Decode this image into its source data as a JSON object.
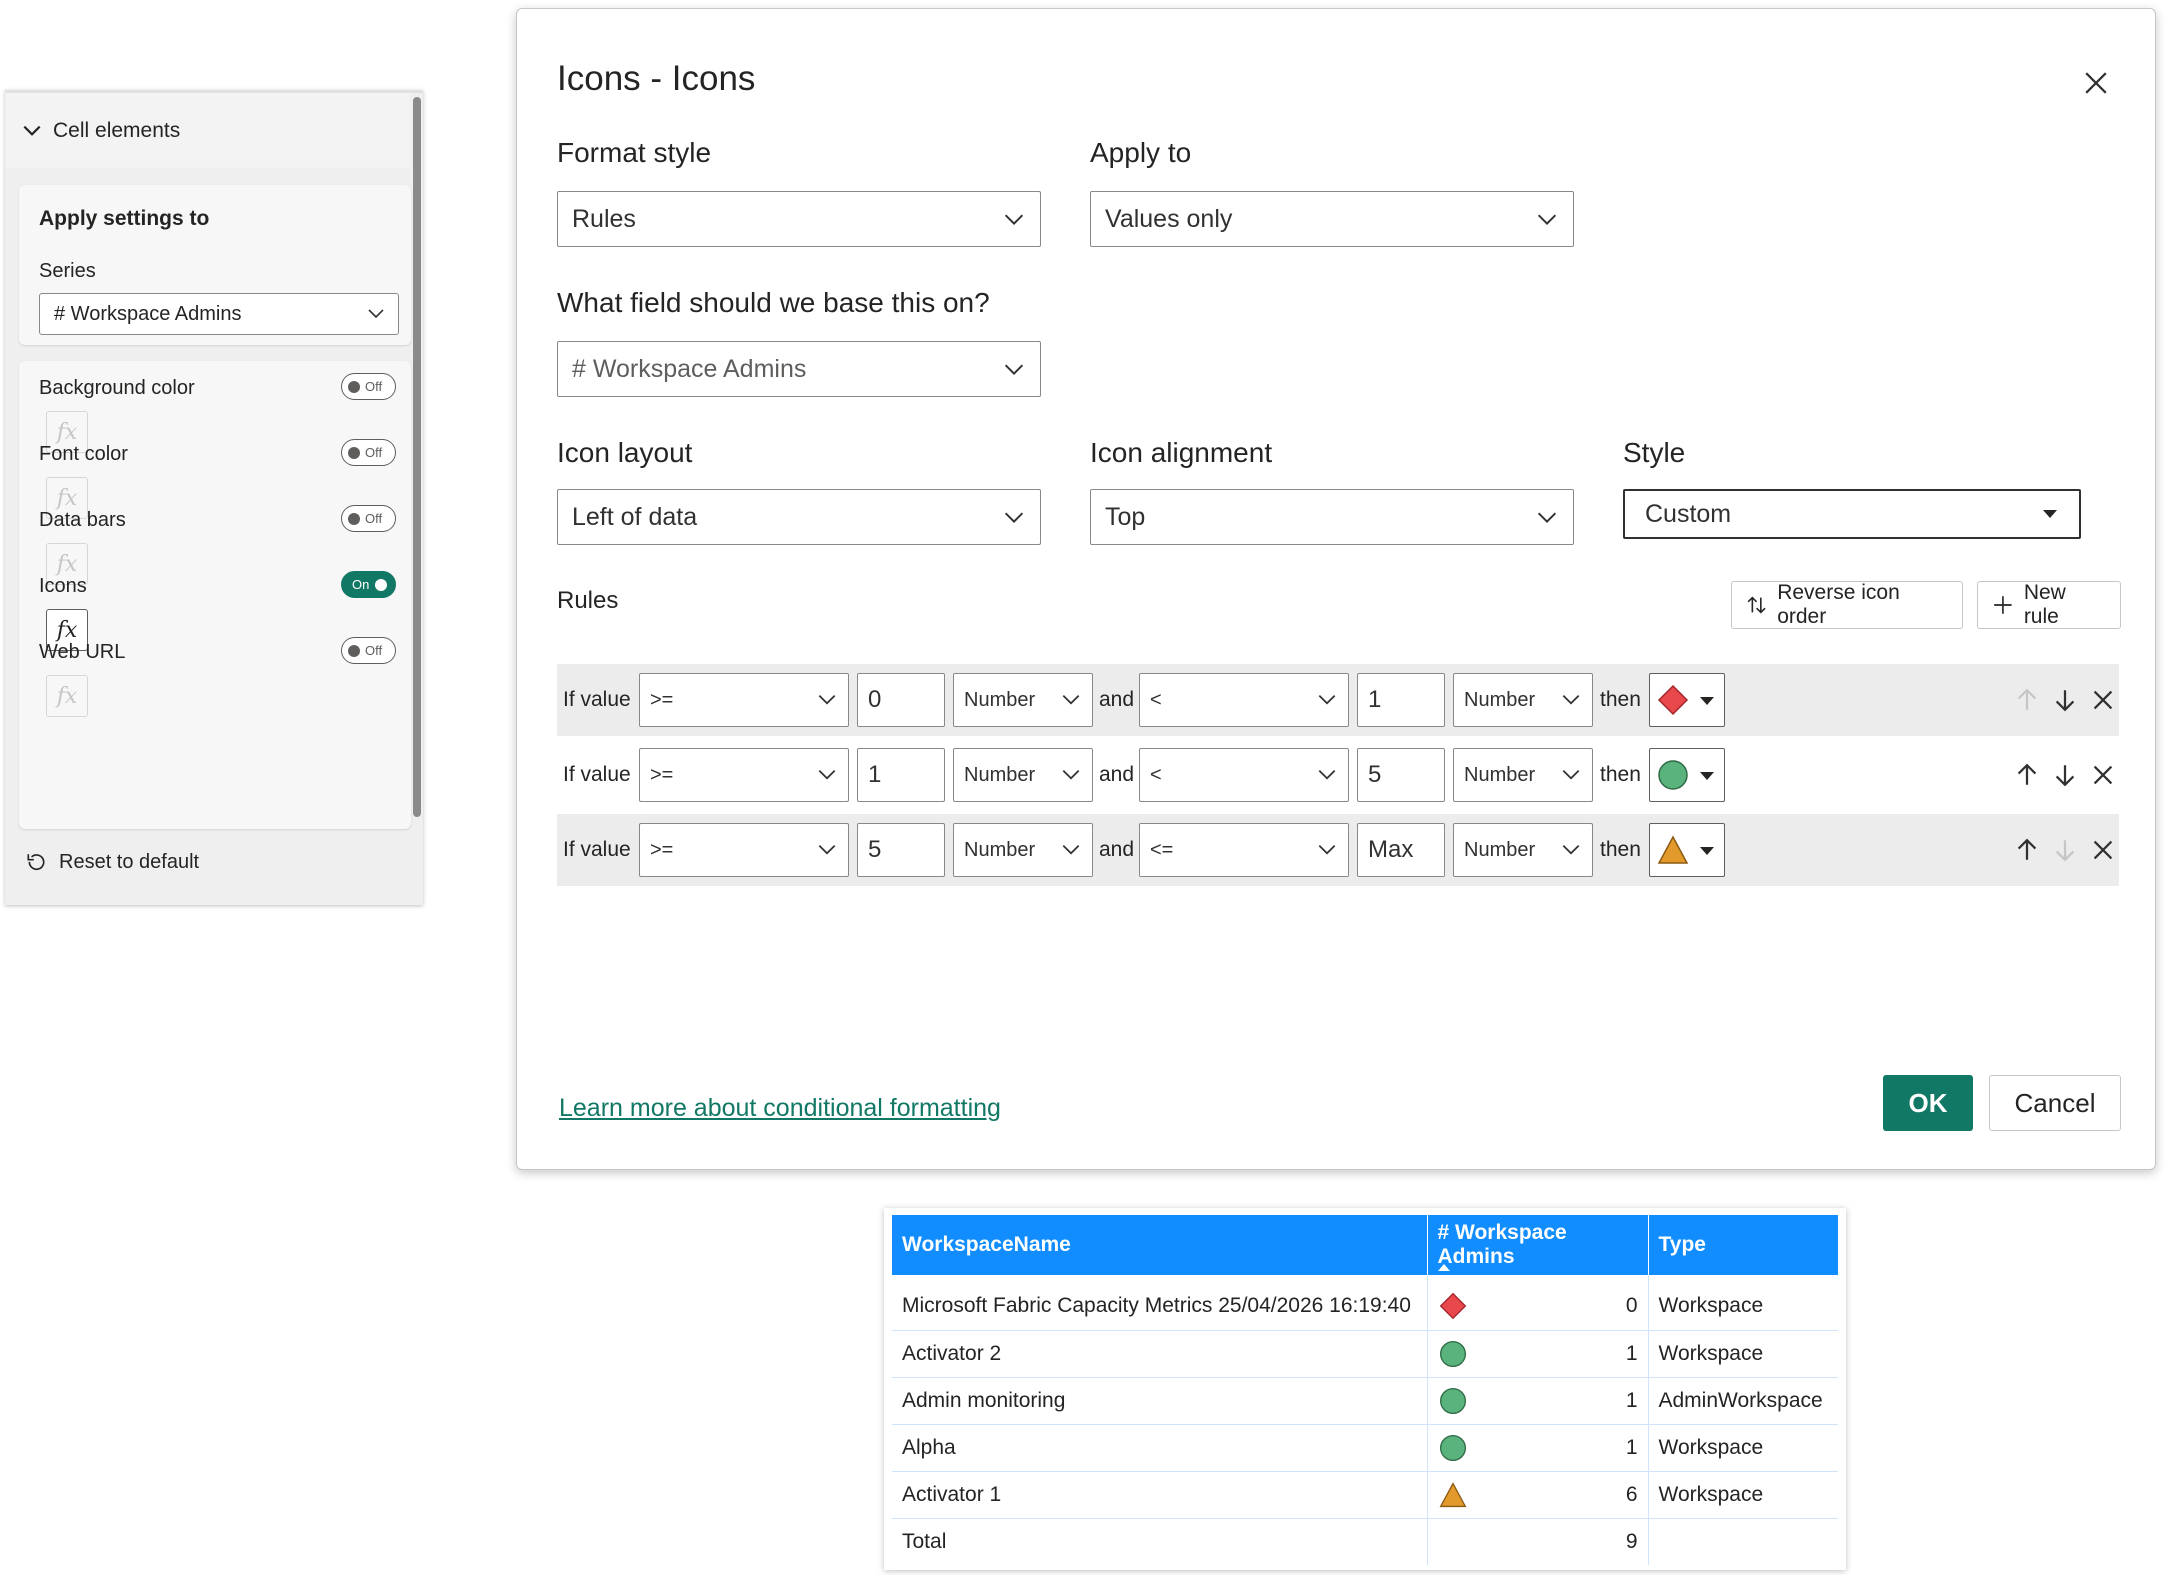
{
  "format_pane": {
    "section_title": "Cell elements",
    "apply_settings_title": "Apply settings to",
    "series_label": "Series",
    "series_value": "# Workspace Admins",
    "elements": [
      {
        "label": "Background color",
        "toggle": "Off"
      },
      {
        "label": "Font color",
        "toggle": "Off"
      },
      {
        "label": "Data bars",
        "toggle": "Off"
      },
      {
        "label": "Icons",
        "toggle": "On"
      },
      {
        "label": "Web URL",
        "toggle": "Off"
      }
    ],
    "fx_label": "fx",
    "reset_label": "Reset to default"
  },
  "dialog": {
    "title": "Icons - Icons",
    "format_style_label": "Format style",
    "format_style_value": "Rules",
    "apply_to_label": "Apply to",
    "apply_to_value": "Values only",
    "base_field_label": "What field should we base this on?",
    "base_field_value": "# Workspace Admins",
    "icon_layout_label": "Icon layout",
    "icon_layout_value": "Left of data",
    "icon_alignment_label": "Icon alignment",
    "icon_alignment_value": "Top",
    "style_label": "Style",
    "style_value": "Custom",
    "rules_label": "Rules",
    "reverse_label": "Reverse icon order",
    "new_rule_label": "New rule",
    "rules": [
      {
        "if": "If value",
        "op1": ">=",
        "val1": "0",
        "type1": "Number",
        "and": "and",
        "op2": "<",
        "val2": "1",
        "type2": "Number",
        "then": "then",
        "icon": "red-diamond-icon"
      },
      {
        "if": "If value",
        "op1": ">=",
        "val1": "1",
        "type1": "Number",
        "and": "and",
        "op2": "<",
        "val2": "5",
        "type2": "Number",
        "then": "then",
        "icon": "green-circle-icon"
      },
      {
        "if": "If value",
        "op1": ">=",
        "val1": "5",
        "type1": "Number",
        "and": "and",
        "op2": "<=",
        "val2": "Max",
        "type2": "Number",
        "then": "then",
        "icon": "orange-triangle-icon"
      }
    ],
    "learn_more": "Learn more about conditional formatting",
    "ok_label": "OK",
    "cancel_label": "Cancel"
  },
  "table": {
    "headers": [
      "WorkspaceName",
      "# Workspace Admins",
      "Type"
    ],
    "rows": [
      {
        "name": "Microsoft Fabric Capacity Metrics 25/04/2026 16:19:40",
        "icon": "red-diamond-icon",
        "admins": "0",
        "type": "Workspace"
      },
      {
        "name": "Activator 2",
        "icon": "green-circle-icon",
        "admins": "1",
        "type": "Workspace"
      },
      {
        "name": "Admin monitoring",
        "icon": "green-circle-icon",
        "admins": "1",
        "type": "AdminWorkspace"
      },
      {
        "name": "Alpha",
        "icon": "green-circle-icon",
        "admins": "1",
        "type": "Workspace"
      },
      {
        "name": "Activator 1",
        "icon": "orange-triangle-icon",
        "admins": "6",
        "type": "Workspace"
      }
    ],
    "total": {
      "label": "Total",
      "admins": "9"
    }
  },
  "colors": {
    "accent": "#117865",
    "table_header": "#118dff",
    "red_diamond": "#e8484c",
    "green_circle": "#5ab27c",
    "orange_triangle": "#e39a2d"
  }
}
